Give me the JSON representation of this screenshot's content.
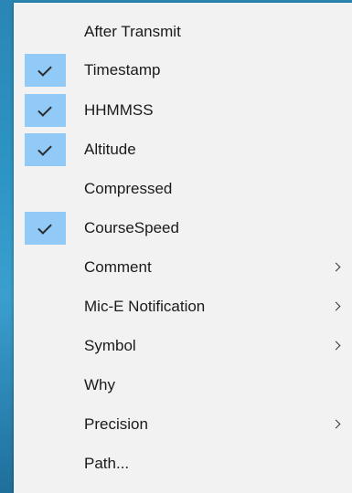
{
  "menu": {
    "items": [
      {
        "label": "After Transmit",
        "checked": false,
        "submenu": false
      },
      {
        "label": "Timestamp",
        "checked": true,
        "submenu": false
      },
      {
        "label": "HHMMSS",
        "checked": true,
        "submenu": false
      },
      {
        "label": "Altitude",
        "checked": true,
        "submenu": false
      },
      {
        "label": "Compressed",
        "checked": false,
        "submenu": false
      },
      {
        "label": "CourseSpeed",
        "checked": true,
        "submenu": false
      },
      {
        "label": "Comment",
        "checked": false,
        "submenu": true
      },
      {
        "label": "Mic-E Notification",
        "checked": false,
        "submenu": true
      },
      {
        "label": "Symbol",
        "checked": false,
        "submenu": true
      },
      {
        "label": "Why",
        "checked": false,
        "submenu": false
      },
      {
        "label": "Precision",
        "checked": false,
        "submenu": true
      },
      {
        "label": "Path...",
        "checked": false,
        "submenu": false
      }
    ]
  },
  "colors": {
    "menu_background": "#f2f2f2",
    "check_highlight": "#91c9f7",
    "desktop": "#2d95c4"
  }
}
